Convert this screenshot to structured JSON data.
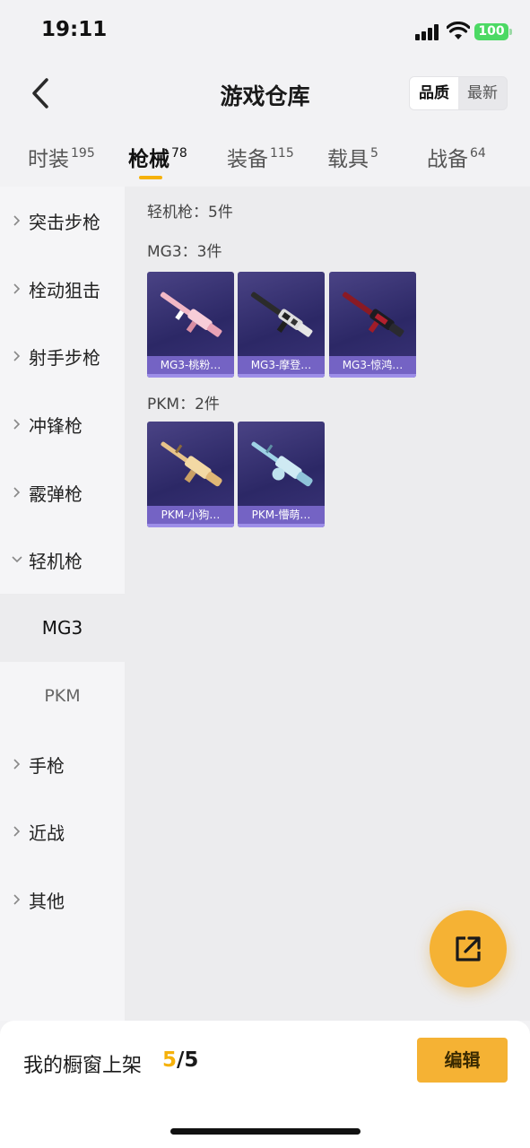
{
  "status_bar": {
    "time": "19:11",
    "battery": "100"
  },
  "header": {
    "title": "游戏仓库",
    "sort_options": [
      "品质",
      "最新"
    ],
    "active_sort": "品质"
  },
  "tabs": [
    {
      "label": "时装",
      "count": "195"
    },
    {
      "label": "枪械",
      "count": "78",
      "active": true
    },
    {
      "label": "装备",
      "count": "115"
    },
    {
      "label": "载具",
      "count": "5"
    },
    {
      "label": "战备",
      "count": "64"
    }
  ],
  "sidebar": {
    "items": [
      "突击步枪",
      "栓动狙击",
      "射手步枪",
      "冲锋枪",
      "霰弹枪",
      "轻机枪",
      "手枪",
      "近战",
      "其他"
    ],
    "expanded": "轻机枪",
    "sub_items": [
      "MG3",
      "PKM"
    ],
    "active_sub": "MG3"
  },
  "content": {
    "summary": "轻机枪：5件",
    "groups": [
      {
        "title": "MG3：3件",
        "items": [
          "MG3-桃粉…",
          "MG3-摩登…",
          "MG3-惊鸿…"
        ]
      },
      {
        "title": "PKM：2件",
        "items": [
          "PKM-小狗…",
          "PKM-懵萌…"
        ]
      }
    ]
  },
  "bottom_bar": {
    "shelf_label": "我的橱窗上架",
    "shelf_current": "5",
    "shelf_total": "/5",
    "edit_label": "编辑"
  },
  "colors": {
    "accent": "#f5b10a",
    "card_bg": "#2c2866",
    "card_label": "#7463c4"
  }
}
